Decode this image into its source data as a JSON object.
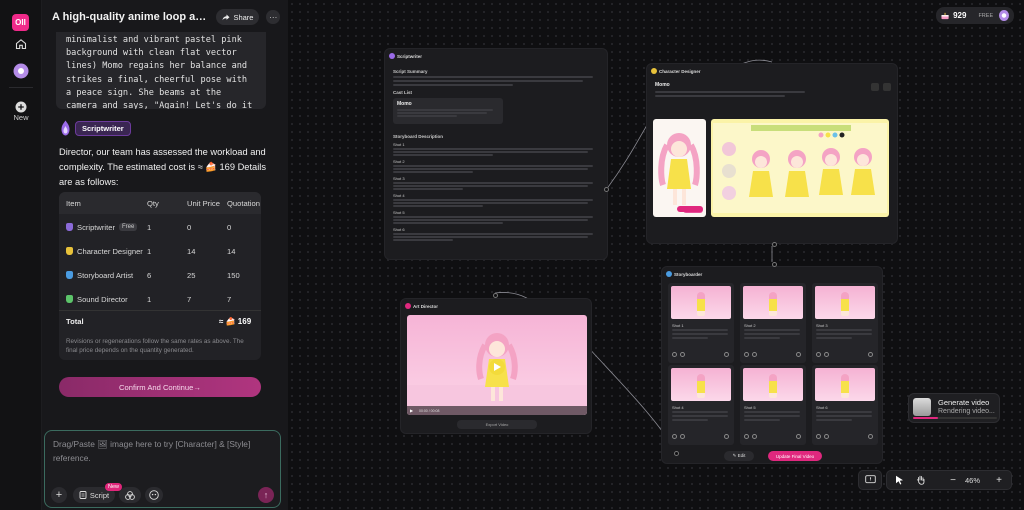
{
  "app": {
    "logo_text": "OII",
    "new_label": "New"
  },
  "chat": {
    "title": "A high-quality anime loop animati...",
    "share_label": "Share",
    "script_excerpt": "minimalist and vibrant pastel pink background with clean flat vector lines) Momo regains her balance and strikes a final, cheerful pose with a peace sign. She beams at the camera and says, \"Again! Let's do it again!\"",
    "agent_badge": "Scriptwriter",
    "message": "Director, our team has assessed the workload and complexity. The estimated cost is ≈ 🍰 169 Details are as follows:",
    "table": {
      "headers": [
        "Item",
        "Qty",
        "Unit Price",
        "Quotation"
      ],
      "rows": [
        {
          "item": "Scriptwriter",
          "tag": "Free",
          "qty": "1",
          "unit": "0",
          "quote": "0",
          "color": "#8b6ad8"
        },
        {
          "item": "Character Designer",
          "tag": "",
          "qty": "1",
          "unit": "14",
          "quote": "14",
          "color": "#e8c23a"
        },
        {
          "item": "Storyboard Artist",
          "tag": "",
          "qty": "6",
          "unit": "25",
          "quote": "150",
          "color": "#4a9be0"
        },
        {
          "item": "Sound Director",
          "tag": "",
          "qty": "1",
          "unit": "7",
          "quote": "7",
          "color": "#5cc46a"
        }
      ],
      "total_label": "Total",
      "total_value": "≈ 🍰 169",
      "note": "Revisions or regenerations follow the same rates as above. The final price depends on the quantity generated."
    },
    "confirm_label": "Confirm And Continue→",
    "input_placeholder": "Drag/Paste 🖼 image here to try [Character] & [Style] reference.",
    "tools": {
      "plus": "+",
      "script": "Script",
      "new_tag": "New"
    }
  },
  "canvas": {
    "credits": "929",
    "plan": "FREE",
    "nodes": {
      "script_title": "Scriptwriter",
      "script_summary": "Script Summary",
      "cast_list": "Cast List",
      "cast_name": "Momo",
      "storyboard_desc": "Storyboard Description",
      "shots": [
        "Shot 1",
        "Shot 2",
        "Shot 3",
        "Shot 4",
        "Shot 5",
        "Shot 6"
      ],
      "char_title": "Character Designer",
      "char_name": "Momo",
      "art_title": "Art Director",
      "export_label": "Export Video",
      "sb_title": "Storyboarder",
      "sb_shots": [
        "Shot 1",
        "Shot 2",
        "Shot 3",
        "Shot 4",
        "Shot 5",
        "Shot 6"
      ],
      "edit_label": "✎ Edit",
      "update_label": "Update Final Video",
      "video_time": "00:00 / 00:08"
    },
    "toast": {
      "title": "Generate video",
      "status": "Rendering video...",
      "progress": 0.3
    },
    "zoom": "46%"
  },
  "colors": {
    "accent": "#e0287e",
    "panel": "#18181b",
    "canvas": "#0f0f11"
  }
}
